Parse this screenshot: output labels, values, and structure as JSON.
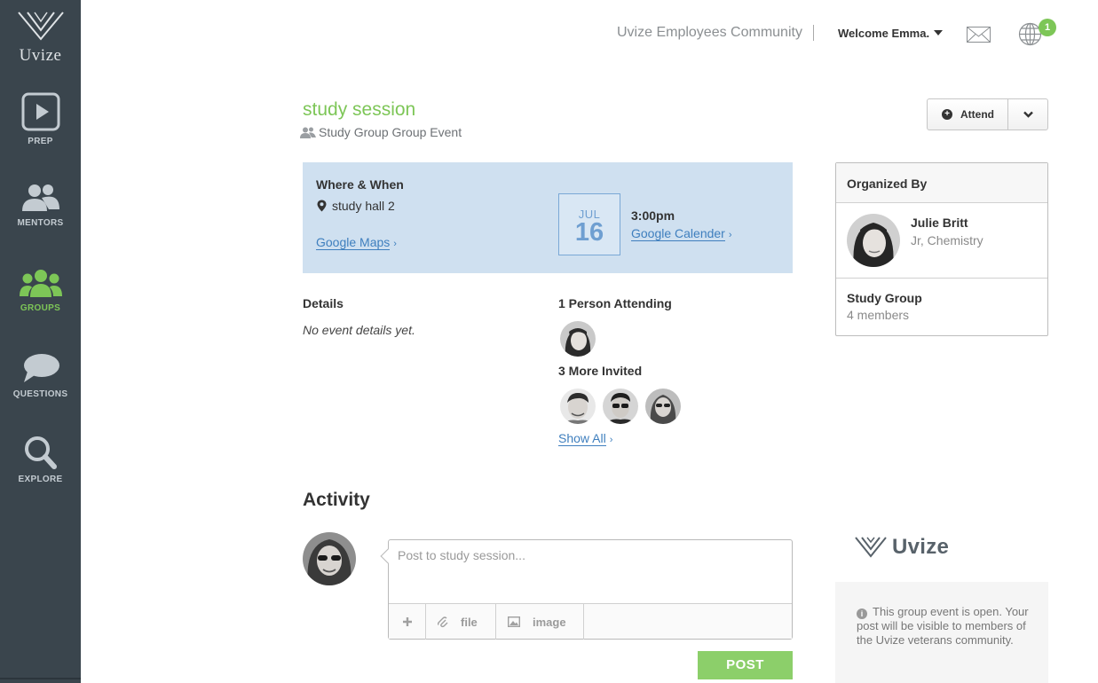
{
  "sidebar": {
    "logo_text": "Uvize",
    "items": [
      {
        "label": "PREP",
        "icon": "play-icon"
      },
      {
        "label": "MENTORS",
        "icon": "mentors-icon"
      },
      {
        "label": "GROUPS",
        "icon": "groups-icon"
      },
      {
        "label": "QUESTIONS",
        "icon": "questions-icon"
      },
      {
        "label": "EXPLORE",
        "icon": "search-icon"
      }
    ],
    "active_item": "GROUPS"
  },
  "header": {
    "community_name": "Uvize Employees Community",
    "welcome_text": "Welcome Emma.",
    "notification_count": "1"
  },
  "event": {
    "title": "study session",
    "subtitle": "Study Group Group Event",
    "attend_label": "Attend"
  },
  "where_when": {
    "title": "Where & When",
    "location": "study hall 2",
    "maps_link": "Google Maps",
    "month": "JUL",
    "day": "16",
    "time": "3:00pm",
    "calendar_link": "Google Calender"
  },
  "details": {
    "title": "Details",
    "text": "No event details yet."
  },
  "attendance": {
    "attending_title": "1 Person Attending",
    "invited_title": "3 More Invited",
    "show_all": "Show All"
  },
  "organizer": {
    "heading": "Organized By",
    "name": "Julie Britt",
    "role": "Jr, Chemistry",
    "group_name": "Study Group",
    "group_members": "4 members"
  },
  "activity": {
    "title": "Activity",
    "post_placeholder": "Post to study session...",
    "file_label": "file",
    "image_label": "image",
    "post_button": "POST"
  },
  "info": {
    "brand": "Uvize",
    "message": "This group event is open. Your post will be visible to members of the Uvize veterans community."
  },
  "colors": {
    "accent_green": "#7dc657",
    "sidebar_bg": "#3a454d",
    "link_blue": "#3f7fbe",
    "where_bg": "#cfe0f0"
  }
}
